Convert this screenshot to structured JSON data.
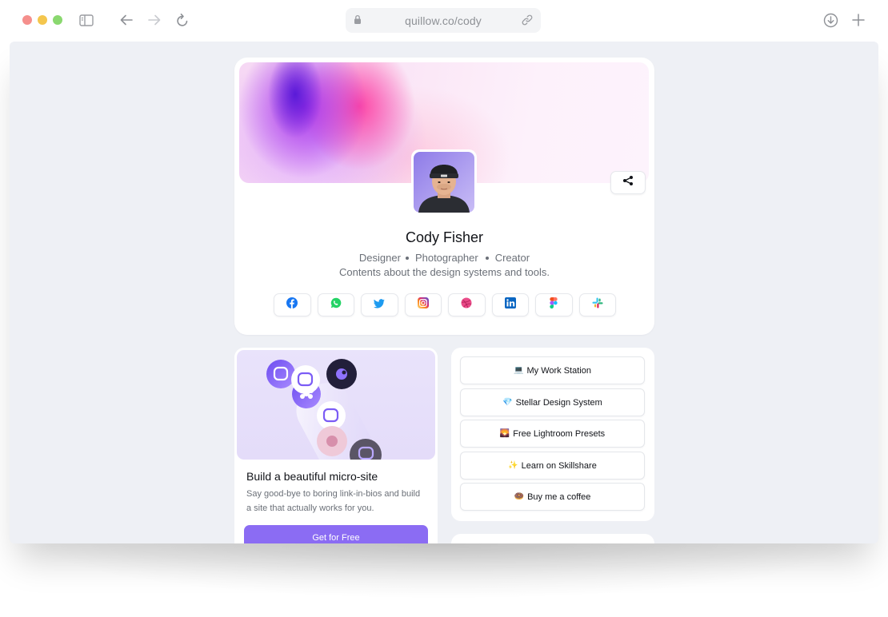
{
  "browser": {
    "url": "quillow.co/cody",
    "icons": [
      "sidebar-icon",
      "back-icon",
      "forward-icon",
      "reload-icon",
      "lock-icon",
      "link-icon",
      "download-icon",
      "new-tab-icon"
    ]
  },
  "profile": {
    "name": "Cody Fisher",
    "roles": [
      "Designer",
      "Photographer",
      "Creator"
    ],
    "tagline": "Contents about the design systems and tools.",
    "socials": [
      "facebook",
      "whatsapp",
      "twitter",
      "instagram",
      "dribbble",
      "linkedin",
      "figma",
      "slack"
    ]
  },
  "promo": {
    "title": "Build a beautiful micro-site",
    "description": "Say good-bye to boring link-in-bios and build a site that actually works for you.",
    "cta": "Get for Free"
  },
  "links": [
    {
      "emoji": "💻",
      "label": "My Work Station"
    },
    {
      "emoji": "💎",
      "label": "Stellar Design System"
    },
    {
      "emoji": "🌄",
      "label": "Free Lightroom Presets"
    },
    {
      "emoji": "✨",
      "label": "Learn on Skillshare"
    },
    {
      "emoji": "🍩",
      "label": "Buy me a coffee"
    }
  ],
  "colors": {
    "accent": "#8b6cf3",
    "viewport_bg": "#eef0f5",
    "text_muted": "#6b7078"
  }
}
